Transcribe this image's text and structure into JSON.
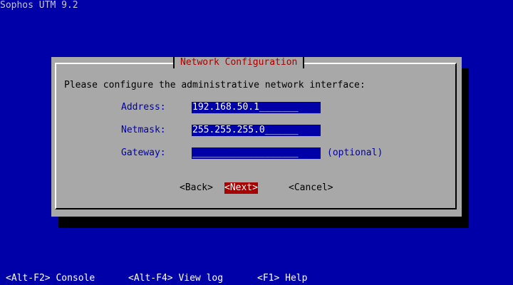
{
  "app": {
    "title": "Sophos UTM 9.2"
  },
  "dialog": {
    "title": "Network Configuration",
    "prompt": "Please configure the administrative network interface:",
    "fields": [
      {
        "label": "Address:",
        "value": "192.168.50.1_______",
        "hint": ""
      },
      {
        "label": "Netmask:",
        "value": "255.255.255.0______",
        "hint": ""
      },
      {
        "label": "Gateway:",
        "value": "___________________",
        "hint": "(optional)"
      }
    ],
    "buttons": {
      "back": "<Back>",
      "next": "<Next>",
      "cancel": "<Cancel>"
    }
  },
  "footer": {
    "console": "<Alt-F2> Console",
    "view_log": "<Alt-F4> View log",
    "help": "<F1> Help"
  },
  "colors": {
    "background": "#0000a8",
    "dialog": "#a8a8a8",
    "accent": "#a80000",
    "input": "#0000a8"
  }
}
